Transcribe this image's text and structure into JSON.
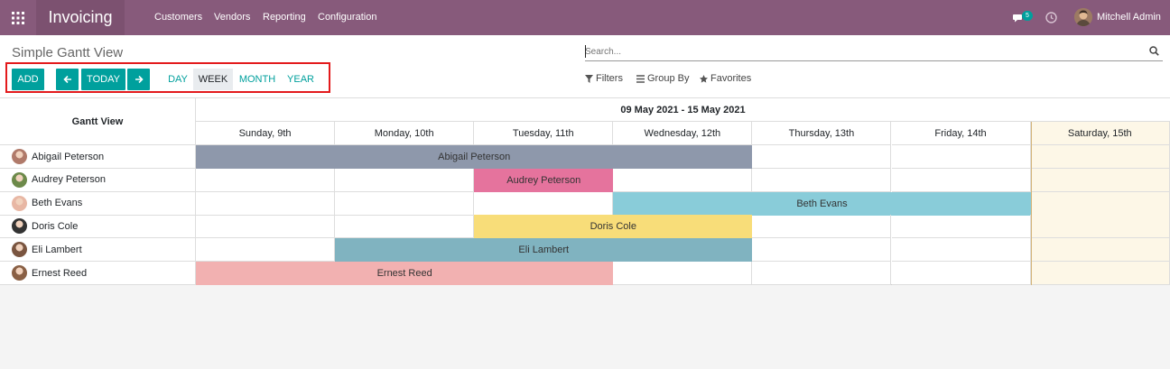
{
  "app": {
    "title": "Invoicing",
    "menu": [
      "Customers",
      "Vendors",
      "Reporting",
      "Configuration"
    ],
    "chat_count": "5",
    "user_name": "Mitchell Admin"
  },
  "control": {
    "page_title": "Simple Gantt View",
    "add_label": "ADD",
    "today_label": "TODAY",
    "scales": [
      "DAY",
      "WEEK",
      "MONTH",
      "YEAR"
    ],
    "active_scale": "WEEK",
    "search_placeholder": "Search...",
    "filters_label": "Filters",
    "groupby_label": "Group By",
    "favorites_label": "Favorites"
  },
  "gantt": {
    "title": "Gantt View",
    "range": "09 May 2021 - 15 May 2021",
    "days": [
      "Sunday, 9th",
      "Monday, 10th",
      "Tuesday, 11th",
      "Wednesday, 12th",
      "Thursday, 13th",
      "Friday, 14th",
      "Saturday, 15th"
    ],
    "highlight_day": 6,
    "rows": [
      {
        "name": "Abigail Peterson",
        "avatar_color": "#b07a6a",
        "bar": {
          "label": "Abigail Peterson",
          "start": 0,
          "span": 4,
          "color": "#8e98ab"
        }
      },
      {
        "name": "Audrey Peterson",
        "avatar_color": "#6d8a4a",
        "bar": {
          "label": "Audrey Peterson",
          "start": 2,
          "span": 1,
          "color": "#e5739d"
        }
      },
      {
        "name": "Beth Evans",
        "avatar_color": "#e8b7a4",
        "bar": {
          "label": "Beth Evans",
          "start": 3,
          "span": 3,
          "color": "#89ccd9"
        }
      },
      {
        "name": "Doris Cole",
        "avatar_color": "#333333",
        "bar": {
          "label": "Doris Cole",
          "start": 2,
          "span": 2,
          "color": "#f8dd79"
        }
      },
      {
        "name": "Eli Lambert",
        "avatar_color": "#7a5540",
        "bar": {
          "label": "Eli Lambert",
          "start": 1,
          "span": 3,
          "color": "#80b3c0"
        }
      },
      {
        "name": "Ernest Reed",
        "avatar_color": "#8a6045",
        "bar": {
          "label": "Ernest Reed",
          "start": 0,
          "span": 3,
          "color": "#f2b1b1"
        }
      }
    ]
  },
  "colors": {
    "brand": "#875a7b",
    "accent": "#00a09d",
    "highlight_box": "#e31a1c"
  },
  "icons": {
    "apps": "grid-icon",
    "chat": "chat-bubble-icon",
    "clock": "clock-icon",
    "search": "search-icon",
    "prev": "arrow-left-icon",
    "next": "arrow-right-icon",
    "filter": "funnel-icon",
    "groupby": "list-icon",
    "favorites": "star-icon"
  }
}
